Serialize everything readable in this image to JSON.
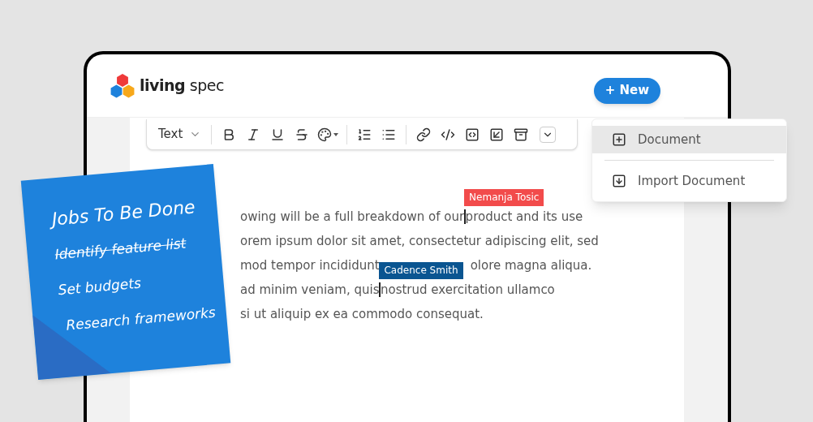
{
  "header": {
    "logo": "**living** spec",
    "new_button": "+ New"
  },
  "toolbar": {
    "text_style": "Text"
  },
  "menu": {
    "items": [
      {
        "label": "Document",
        "kind": "new",
        "selected": true
      },
      {
        "label": "Import Document",
        "kind": "import",
        "selected": false
      }
    ]
  },
  "editor": {
    "lines": [
      [
        {
          "kind": "text",
          "text": "owing will be a full breakdown of our "
        },
        {
          "kind": "cursor",
          "name": "Nemanja Tosic",
          "color": "#f24b4b"
        },
        {
          "kind": "text",
          "text": "product and its use"
        }
      ],
      [
        {
          "kind": "text",
          "text": "orem ipsum dolor sit amet, consectetur adipiscing elit, sed"
        }
      ],
      [
        {
          "kind": "text",
          "text": "mod tempor incididunt"
        },
        {
          "kind": "text",
          "text": "olore magna aliqua."
        }
      ],
      [
        {
          "kind": "text",
          "text": "ad minim veniam, quis"
        },
        {
          "kind": "cursor",
          "name": "Cadence Smith",
          "color": "#0a5591"
        },
        {
          "kind": "text",
          "text": "nostrud exercitation ullamco"
        }
      ],
      [
        {
          "kind": "text",
          "text": "si ut aliquip ex ea commodo consequat."
        }
      ]
    ]
  },
  "note": {
    "title": "Jobs To Be Done",
    "items": [
      {
        "text": "Identify feature list",
        "done": true
      },
      {
        "text": "Set budgets",
        "done": false
      },
      {
        "text": "Research frameworks",
        "done": false
      }
    ]
  }
}
